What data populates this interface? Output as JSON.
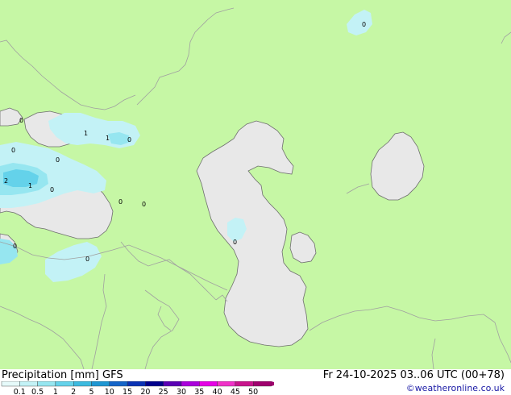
{
  "title": "Precipitation [mm] GFS",
  "datetime": "Fr 24-10-2025 03..06 UTC (00+78)",
  "credit": "©weatheronline.co.uk",
  "scale": {
    "colors": [
      "#e6fafa",
      "#c3f2f6",
      "#96e6f0",
      "#64d2ea",
      "#3cbadf",
      "#1e96d2",
      "#1464c8",
      "#0a32b4",
      "#00008c",
      "#5a00b4",
      "#aa00dc",
      "#e600e6",
      "#f032c8",
      "#c8148c",
      "#a0006e"
    ],
    "labels": [
      "0.1",
      "0.5",
      "1",
      "2",
      "5",
      "10",
      "15",
      "20",
      "25",
      "30",
      "35",
      "40",
      "45",
      "50"
    ]
  },
  "map_labels": [
    "0",
    "1",
    "1",
    "0",
    "0",
    "0",
    "2",
    "1",
    "0",
    "0",
    "0",
    "0",
    "0",
    "0",
    "0"
  ],
  "colors": {
    "land": "#c6f7a5",
    "sea": "#e8e8e8",
    "border": "#a0a0a0",
    "coast": "#6e6e6e",
    "precip_light": "#c3f2f6",
    "precip_medium": "#96e6f0",
    "precip_heavy": "#64d2ea"
  }
}
